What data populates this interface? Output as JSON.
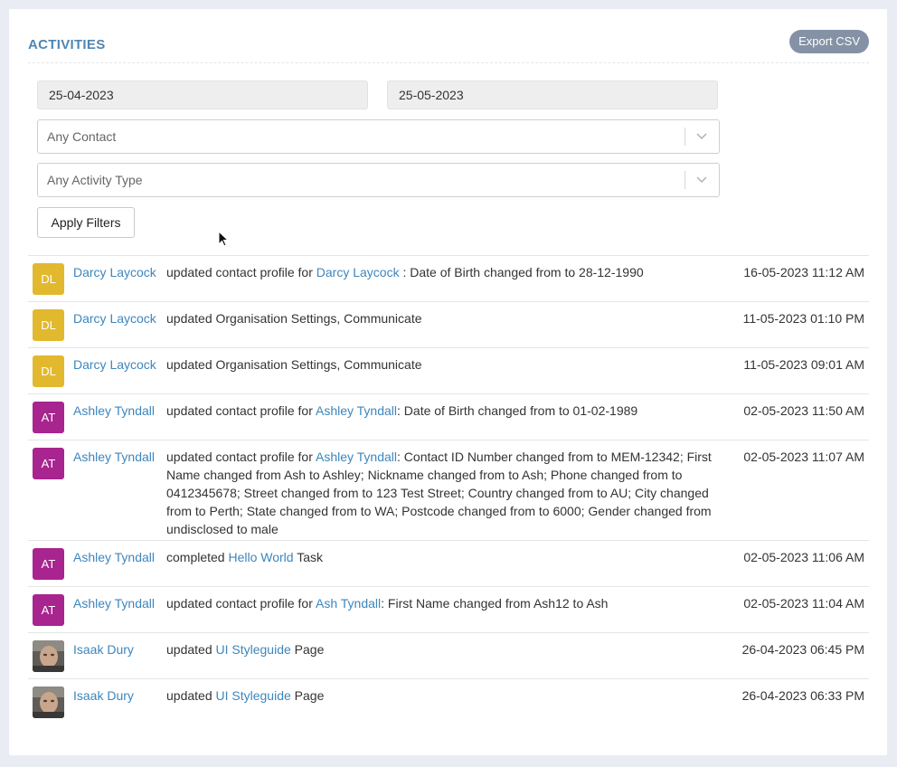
{
  "header": {
    "title": "ACTIVITIES",
    "export_label": "Export CSV"
  },
  "filters": {
    "date_from": "25-04-2023",
    "date_to": "25-05-2023",
    "contact_placeholder": "Any Contact",
    "activity_type_placeholder": "Any Activity Type",
    "apply_label": "Apply Filters"
  },
  "colors": {
    "accent_title": "#4f86b3",
    "link": "#3d86bd",
    "avatar_dl": "#e2b92e",
    "avatar_at": "#a8248f",
    "export_button": "#8592a6"
  },
  "activities": [
    {
      "initials": "DL",
      "user": "Darcy Laycock",
      "parts": [
        {
          "t": "updated contact profile for "
        },
        {
          "t": "Darcy Laycock",
          "link": true
        },
        {
          "t": " : Date of Birth changed from to 28-12-1990"
        }
      ],
      "time": "16-05-2023 11:12 AM"
    },
    {
      "initials": "DL",
      "user": "Darcy Laycock",
      "parts": [
        {
          "t": "updated Organisation Settings, Communicate"
        }
      ],
      "time": "11-05-2023 01:10 PM"
    },
    {
      "initials": "DL",
      "user": "Darcy Laycock",
      "parts": [
        {
          "t": "updated Organisation Settings, Communicate"
        }
      ],
      "time": "11-05-2023 09:01 AM"
    },
    {
      "initials": "AT",
      "user": "Ashley Tyndall",
      "parts": [
        {
          "t": "updated contact profile for "
        },
        {
          "t": "Ashley Tyndall",
          "link": true
        },
        {
          "t": ": Date of Birth changed from to 01-02-1989"
        }
      ],
      "time": "02-05-2023 11:50 AM"
    },
    {
      "initials": "AT",
      "user": "Ashley Tyndall",
      "parts": [
        {
          "t": "updated contact profile for "
        },
        {
          "t": "Ashley Tyndall",
          "link": true
        },
        {
          "t": ": Contact ID Number changed from to MEM-12342; First Name changed from Ash to Ashley; Nickname changed from to Ash; Phone changed from to 0412345678; Street changed from to 123 Test Street; Country changed from to AU; City changed from to Perth; State changed from to WA; Postcode changed from to 6000; Gender changed from undisclosed to male"
        }
      ],
      "time": "02-05-2023 11:07 AM"
    },
    {
      "initials": "AT",
      "user": "Ashley Tyndall",
      "parts": [
        {
          "t": "completed "
        },
        {
          "t": "Hello World",
          "link": true
        },
        {
          "t": " Task"
        }
      ],
      "time": "02-05-2023 11:06 AM"
    },
    {
      "initials": "AT",
      "user": "Ashley Tyndall",
      "parts": [
        {
          "t": "updated contact profile for "
        },
        {
          "t": "Ash Tyndall",
          "link": true
        },
        {
          "t": ": First Name changed from Ash12 to Ash"
        }
      ],
      "time": "02-05-2023 11:04 AM"
    },
    {
      "initials": "",
      "photo": true,
      "user": "Isaak Dury",
      "parts": [
        {
          "t": "updated "
        },
        {
          "t": "UI Styleguide",
          "link": true
        },
        {
          "t": " Page"
        }
      ],
      "time": "26-04-2023 06:45 PM"
    },
    {
      "initials": "",
      "photo": true,
      "user": "Isaak Dury",
      "parts": [
        {
          "t": "updated "
        },
        {
          "t": "UI Styleguide",
          "link": true
        },
        {
          "t": " Page"
        }
      ],
      "time": "26-04-2023 06:33 PM"
    }
  ]
}
